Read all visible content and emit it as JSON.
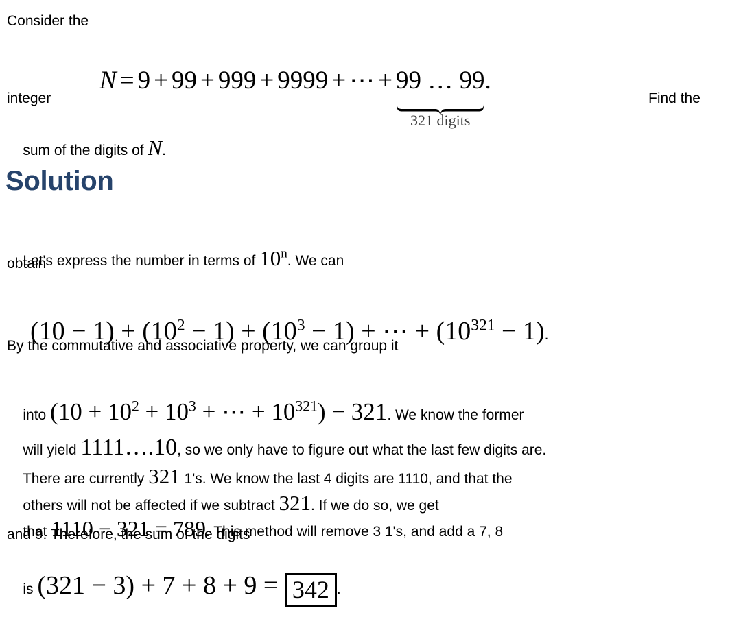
{
  "document": {
    "type": "math-solution",
    "background_color": "#ffffff",
    "text_color": "#000000",
    "heading_color": "#26436b"
  },
  "problem": {
    "intro_text": "Consider the",
    "equation": {
      "lhs": "N",
      "equals": "=",
      "terms": [
        "9",
        "99",
        "999",
        "9999"
      ],
      "ellipsis": "⋯",
      "plus": "+",
      "last_term": "99 … 99",
      "period": ".",
      "underbrace_label": "321 digits"
    },
    "after_equation_text": "integer",
    "right_text": "Find the",
    "closing_text_pre": "sum of the digits of ",
    "closing_math": "N",
    "closing_text_post": "."
  },
  "solution": {
    "heading": "Solution",
    "para1_pre": "Let's express the number in terms of ",
    "para1_math_base": "10",
    "para1_math_exp": "n",
    "para1_post": ". We can",
    "para1_line2": "obtain",
    "display1": {
      "group1": "(10 − 1)",
      "plus1": "+",
      "group2_base": "(10",
      "group2_exp": "2",
      "group2_tail": " − 1)",
      "plus2": "+",
      "group3_base": "(10",
      "group3_exp": "3",
      "group3_tail": " − 1)",
      "plus3": "+",
      "ellipsis": "⋯",
      "plus4": "+",
      "group4_base": "(10",
      "group4_exp": "321",
      "group4_tail": " − 1)",
      "trailing_period": "."
    },
    "para2": "By the commutative and associative property, we can group it",
    "line_into": {
      "pre": "into ",
      "expr_open": "(10 + 10",
      "expr_exp1": "2",
      "expr_mid": " + 10",
      "expr_exp2": "3",
      "expr_ellipsis": " + ⋯ + 10",
      "expr_exp3": "321",
      "expr_close": ") − 321",
      "post": ". We know the former"
    },
    "line_willyield": {
      "pre": "will yield ",
      "math": "1111….10",
      "post": ", so we only have to figure out what the last few digits are."
    },
    "line_currently": {
      "pre": "There are currently ",
      "math": "321",
      "post": " 1's. We know the last 4 digits are 1110, and that the"
    },
    "line_others": {
      "pre": "others will not be affected if we subtract ",
      "math": "321",
      "post": ". If we do so, we get"
    },
    "line_that": {
      "pre": "that ",
      "math": "1110 − 321 = 789",
      "post": ". This method will remove 3 1's, and add a 7, 8"
    },
    "line_and9": "and 9. Therefore, the sum of the digits",
    "line_is": {
      "pre": "is ",
      "math": "(321 − 3) + 7 + 8 + 9 = ",
      "boxed_answer": "342",
      "post": "."
    }
  },
  "answer": {
    "value": "342"
  }
}
